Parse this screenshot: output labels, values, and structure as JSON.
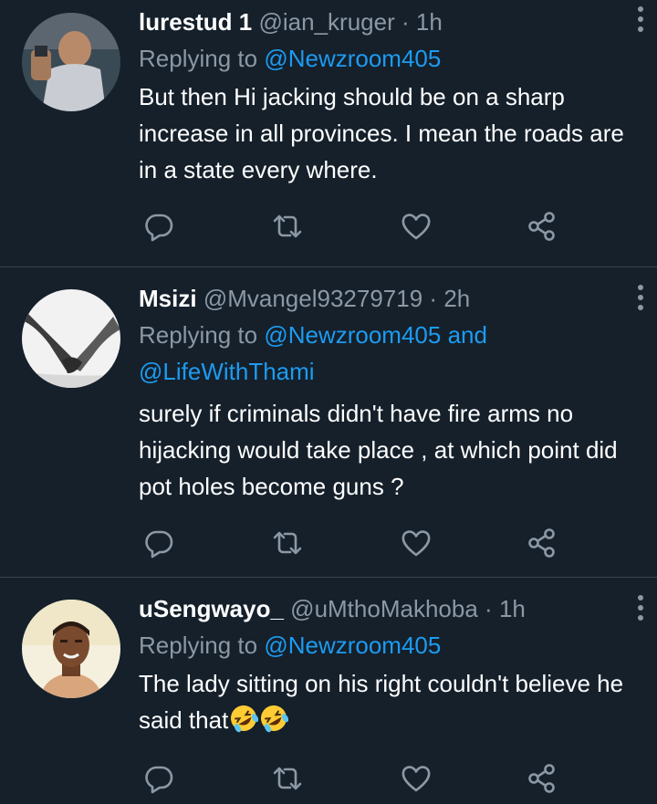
{
  "tweets": [
    {
      "name": "lurestud 1",
      "handle": "@ian_kruger",
      "separator": "·",
      "time": "1h",
      "replying_prefix": "Replying to ",
      "replying_to": [
        "@Newzroom405"
      ],
      "replying_joiner": "",
      "text": "But then Hi jacking should be on a sharp increase in all provinces. I mean the roads are in a state every where."
    },
    {
      "name": "Msizi",
      "handle": "@Mvangel93279719",
      "separator": "·",
      "time": "2h",
      "replying_prefix": "Replying to ",
      "replying_to": [
        "@Newzroom405",
        "@LifeWithThami"
      ],
      "replying_joiner": " and ",
      "text": "surely if criminals didn't have fire arms no hijacking would take place , at which point did pot holes become guns ?"
    },
    {
      "name": "uSengwayo_",
      "handle": "@uMthoMakhoba",
      "separator": "·",
      "time": "1h",
      "replying_prefix": "Replying to ",
      "replying_to": [
        "@Newzroom405"
      ],
      "replying_joiner": "",
      "text": "The lady sitting on his right couldn't believe he said that",
      "emojis": [
        "rolling-on-floor-laughing",
        "rolling-on-floor-laughing"
      ]
    }
  ],
  "icons": {
    "more": "more-vertical-icon",
    "reply": "reply-bubble-icon",
    "retweet": "retweet-icon",
    "like": "heart-icon",
    "share": "share-icon"
  },
  "colors": {
    "background": "#15202b",
    "divider": "#38444d",
    "secondary_text": "#8b98a5",
    "link": "#1d9bf0",
    "icon": "#8b98a5"
  }
}
